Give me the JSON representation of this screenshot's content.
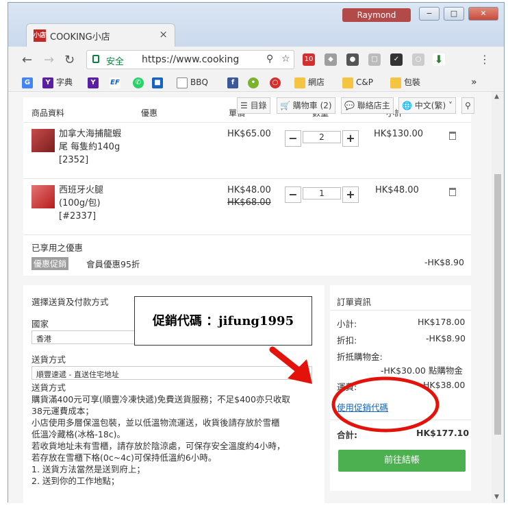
{
  "browser": {
    "user": "Raymond",
    "window_buttons": [
      "−",
      "□",
      "✕"
    ],
    "tab_favicon_text": "小店",
    "tab_title": "COOKING小店",
    "tab_close": "×",
    "secure_label": "安全",
    "url": "https://www.cooking",
    "ext_badge": "10",
    "more_menu": "⋮"
  },
  "bookmarks": {
    "items": [
      {
        "label": "字典",
        "icon": "Y"
      },
      {
        "label": "",
        "icon": "Y"
      },
      {
        "label": "",
        "icon": "EF"
      },
      {
        "label": "BBQ",
        "icon": ""
      },
      {
        "label": "網店",
        "icon": ""
      },
      {
        "label": "C&P",
        "icon": ""
      },
      {
        "label": "包裝",
        "icon": ""
      }
    ],
    "overflow": "»"
  },
  "site_nav": {
    "catalog": "目錄",
    "cart": "購物車 (2)",
    "contact": "聯絡店主",
    "language": "中文(繁)"
  },
  "cart": {
    "headers": {
      "product": "商品資料",
      "discount": "優惠",
      "unit_price": "單價",
      "quantity": "數量",
      "subtotal": "小計"
    },
    "items": [
      {
        "name_lines": [
          "加拿大海捕龍蝦",
          "尾 每隻約140g",
          "[2352]"
        ],
        "price": "HK$65.00",
        "old_price": "",
        "qty": "2",
        "total": "HK$130.00"
      },
      {
        "name_lines": [
          "西班牙火腿",
          "(100g/包)",
          "[#2337]"
        ],
        "price": "HK$48.00",
        "old_price": "HK$68.00",
        "qty": "1",
        "total": "HK$48.00"
      }
    ],
    "qty_minus": "−",
    "qty_plus": "+",
    "discount_title": "已享用之優惠",
    "discount_badge": "優惠促銷",
    "discount_name": "會員優惠95折",
    "discount_amount": "-HK$8.90"
  },
  "shipping": {
    "title": "選擇送貨及付款方式",
    "country_label": "國家",
    "country_value": "香港",
    "method_label": "送貨方式",
    "method_value": "順豐速遞 - 直送住宅地址",
    "desc_title": "送貨方式",
    "desc_lines": [
      "購貨滿400元可享(順豐冷凍快遞)免費送貨服務；不足$400亦只收取",
      "38元運費成本；",
      "小店使用多層保溫包裝，並以低溫物流運送，收貨後請存放於雪櫃",
      "低溫冷藏格(冰格-18c)。",
      "若收貨地址未有雪櫃，請存放於陰涼處，可保存安全溫度約4小時，",
      "若存放在雪櫃下格(0c~4c)可保持低溫約6小時。",
      "1. 送貨方法當然是送到府上；",
      "2. 送到你的工作地點；"
    ]
  },
  "order": {
    "title": "訂單資訊",
    "subtotal_label": "小計:",
    "subtotal_value": "HK$178.00",
    "discount_label": "折扣:",
    "discount_value": "-HK$8.90",
    "credit_label": "折抵購物金:",
    "credit_value": "-HK$30.00 點購物金",
    "shipping_label": "運費:",
    "shipping_value": "HK$38.00",
    "promo_link": "使用促銷代碼",
    "total_label": "合計:",
    "total_value": "HK$177.10",
    "checkout": "前往結帳"
  },
  "annotation": {
    "text": "促銷代碼 ：jifung1995",
    "color": "#e3120b"
  }
}
